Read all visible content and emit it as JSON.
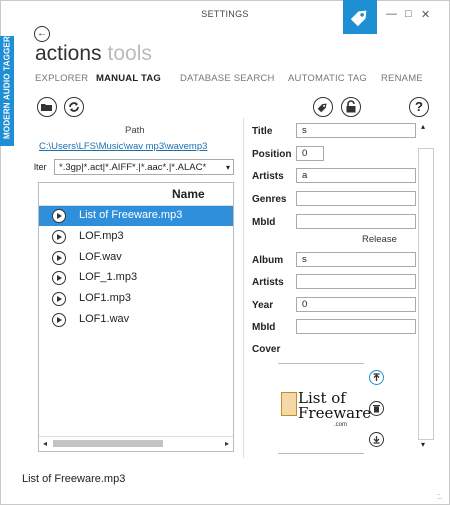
{
  "window": {
    "title": "SETTINGS",
    "controls": {
      "minimize": "—",
      "maximize": "□",
      "close": "✕"
    },
    "sidebar_label": "MODERN AUDIO TAGGER"
  },
  "header": {
    "title": "actions",
    "subtitle": "tools"
  },
  "nav": {
    "items": [
      "EXPLORER",
      "MANUAL TAG",
      "DATABASE SEARCH",
      "AUTOMATIC TAG",
      "RENAME"
    ],
    "active": "MANUAL TAG"
  },
  "toolbar": {
    "left_icons": [
      "open-folder-icon",
      "refresh-icon"
    ],
    "right_icons": [
      "tag-icon",
      "unlock-icon",
      "help-icon"
    ],
    "help_label": "?"
  },
  "path": {
    "label": "Path",
    "value": "C:\\Users\\LFS\\Music\\wav mp3\\wavemp3"
  },
  "filter": {
    "label": "lter",
    "value": "*.3gp|*.act|*.AIFF*.|*.aac*.|*.ALAC*",
    "arrow": "▾"
  },
  "file_list": {
    "header": "Name",
    "rows": [
      {
        "name": "List of Freeware.mp3",
        "selected": true
      },
      {
        "name": "LOF.mp3",
        "selected": false
      },
      {
        "name": "LOF.wav",
        "selected": false
      },
      {
        "name": "LOF_1.mp3",
        "selected": false
      },
      {
        "name": "LOF1.mp3",
        "selected": false
      },
      {
        "name": "LOF1.wav",
        "selected": false
      }
    ],
    "scroll_left": "◂",
    "scroll_right": "▸"
  },
  "track_fields": {
    "title_label": "Title",
    "title_value": "s",
    "position_label": "Position",
    "position_value": "0",
    "artists_label": "Artists",
    "artists_value": "a",
    "genres_label": "Genres",
    "genres_value": "",
    "mbid_label": "MbId",
    "mbid_value": ""
  },
  "release": {
    "heading": "Release",
    "album_label": "Album",
    "album_value": "s",
    "artists_label": "Artists",
    "artists_value": "",
    "year_label": "Year",
    "year_value": "0",
    "mbid_label": "MbId",
    "mbid_value": "",
    "cover_label": "Cover"
  },
  "cover": {
    "logo_line1": "List of",
    "logo_line2": "Freeware",
    "logo_line3": ".com"
  },
  "scrollbar": {
    "up": "▴",
    "down": "▾"
  },
  "status": {
    "selected_file": "List of Freeware.mp3"
  },
  "colors": {
    "accent": "#1e8fd4",
    "selection": "#2f8fda"
  }
}
